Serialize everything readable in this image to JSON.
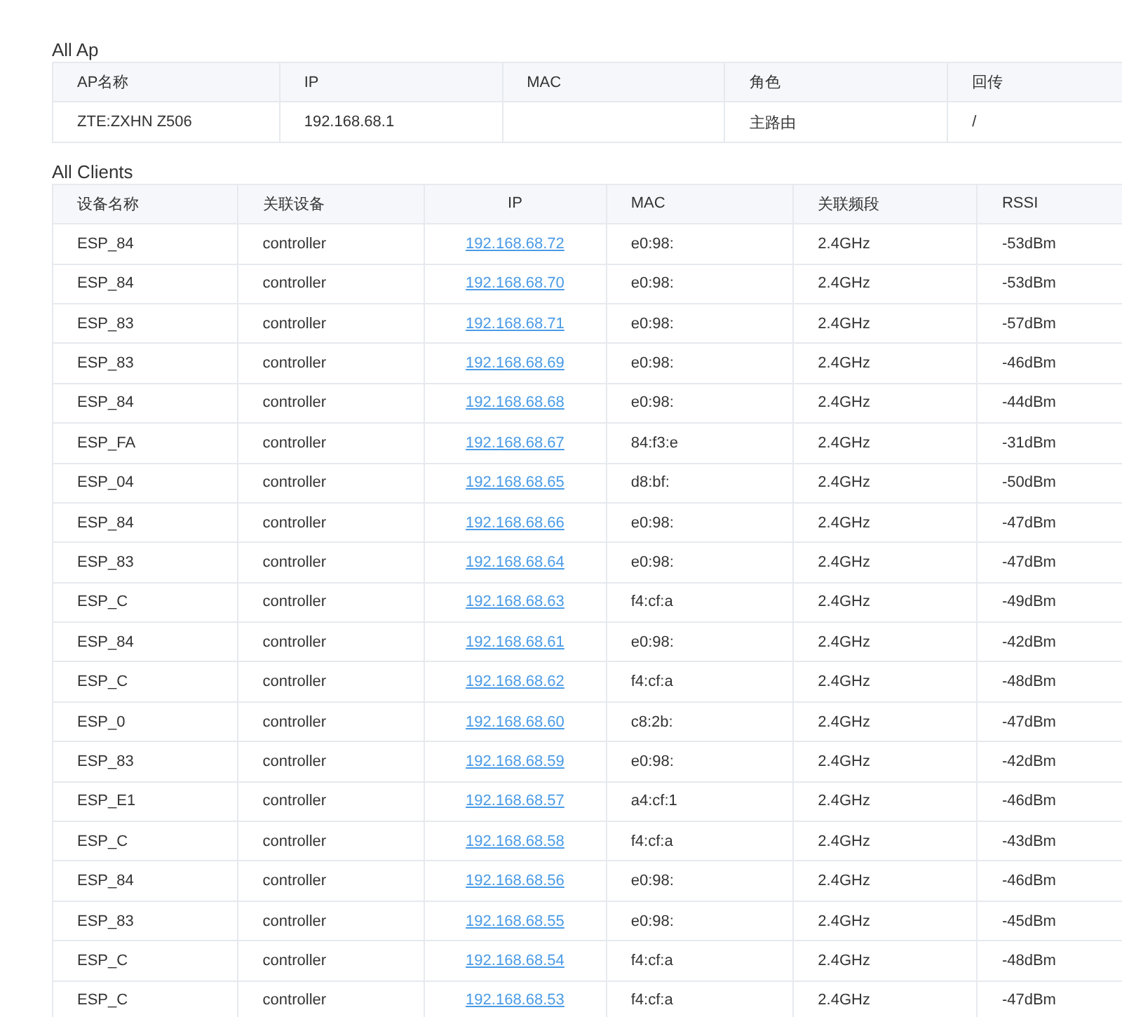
{
  "ap_section": {
    "title": "All Ap",
    "columns": [
      "AP名称",
      "IP",
      "MAC",
      "角色",
      "回传"
    ],
    "rows": [
      [
        "ZTE:ZXHN Z506",
        "192.168.68.1",
        "",
        "主路由",
        "/"
      ]
    ]
  },
  "clients_section": {
    "title": "All Clients",
    "columns": [
      "设备名称",
      "关联设备",
      "IP",
      "MAC",
      "关联频段",
      "RSSI"
    ],
    "rows": [
      [
        "ESP_84",
        "controller",
        "192.168.68.72",
        "e0:98:",
        "2.4GHz",
        "-53dBm"
      ],
      [
        "ESP_84",
        "controller",
        "192.168.68.70",
        "e0:98:",
        "2.4GHz",
        "-53dBm"
      ],
      [
        "ESP_83",
        "controller",
        "192.168.68.71",
        "e0:98:",
        "2.4GHz",
        "-57dBm"
      ],
      [
        "ESP_83",
        "controller",
        "192.168.68.69",
        "e0:98:",
        "2.4GHz",
        "-46dBm"
      ],
      [
        "ESP_84",
        "controller",
        "192.168.68.68",
        "e0:98:",
        "2.4GHz",
        "-44dBm"
      ],
      [
        "ESP_FA",
        "controller",
        "192.168.68.67",
        "84:f3:e",
        "2.4GHz",
        "-31dBm"
      ],
      [
        "ESP_04",
        "controller",
        "192.168.68.65",
        "d8:bf:",
        "2.4GHz",
        "-50dBm"
      ],
      [
        "ESP_84",
        "controller",
        "192.168.68.66",
        "e0:98:",
        "2.4GHz",
        "-47dBm"
      ],
      [
        "ESP_83",
        "controller",
        "192.168.68.64",
        "e0:98:",
        "2.4GHz",
        "-47dBm"
      ],
      [
        "ESP_C",
        "controller",
        "192.168.68.63",
        "f4:cf:a",
        "2.4GHz",
        "-49dBm"
      ],
      [
        "ESP_84",
        "controller",
        "192.168.68.61",
        "e0:98:",
        "2.4GHz",
        "-42dBm"
      ],
      [
        "ESP_C",
        "controller",
        "192.168.68.62",
        "f4:cf:a",
        "2.4GHz",
        "-48dBm"
      ],
      [
        "ESP_0",
        "controller",
        "192.168.68.60",
        "c8:2b:",
        "2.4GHz",
        "-47dBm"
      ],
      [
        "ESP_83",
        "controller",
        "192.168.68.59",
        "e0:98:",
        "2.4GHz",
        "-42dBm"
      ],
      [
        "ESP_E1",
        "controller",
        "192.168.68.57",
        "a4:cf:1",
        "2.4GHz",
        "-46dBm"
      ],
      [
        "ESP_C",
        "controller",
        "192.168.68.58",
        "f4:cf:a",
        "2.4GHz",
        "-43dBm"
      ],
      [
        "ESP_84",
        "controller",
        "192.168.68.56",
        "e0:98:",
        "2.4GHz",
        "-46dBm"
      ],
      [
        "ESP_83",
        "controller",
        "192.168.68.55",
        "e0:98:",
        "2.4GHz",
        "-45dBm"
      ],
      [
        "ESP_C",
        "controller",
        "192.168.68.54",
        "f4:cf:a",
        "2.4GHz",
        "-48dBm"
      ],
      [
        "ESP_C",
        "controller",
        "192.168.68.53",
        "f4:cf:a",
        "2.4GHz",
        "-47dBm"
      ]
    ]
  }
}
